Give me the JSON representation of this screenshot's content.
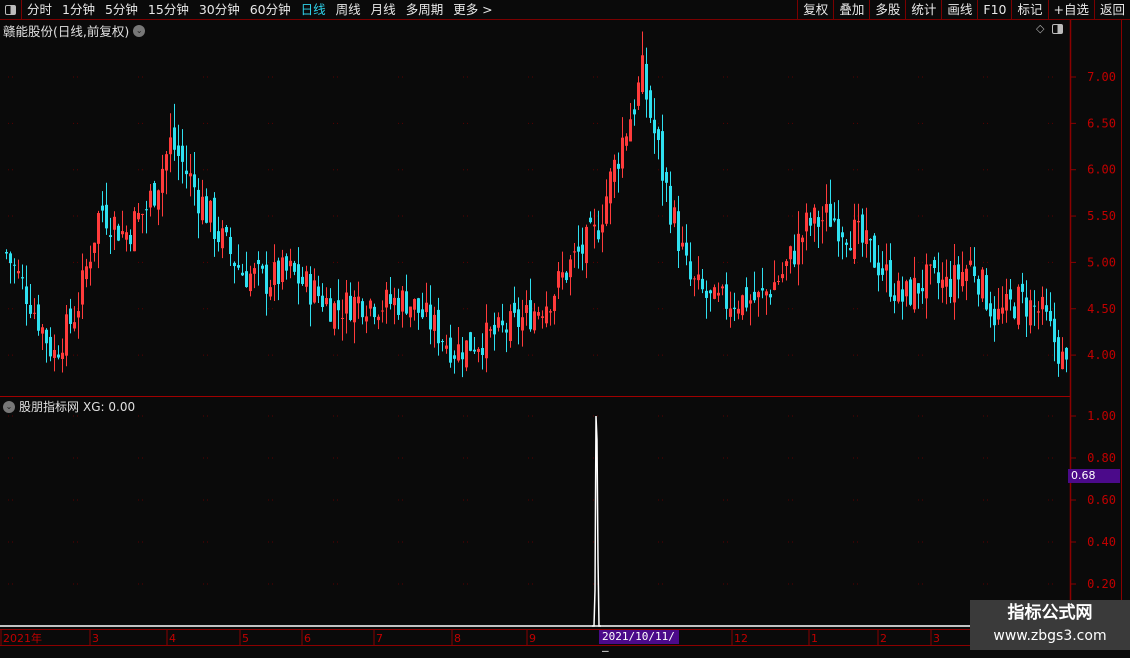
{
  "toolbar": {
    "periods": [
      "分时",
      "1分钟",
      "5分钟",
      "15分钟",
      "30分钟",
      "60分钟",
      "日线",
      "周线",
      "月线",
      "多周期",
      "更多 >"
    ],
    "active_period": "日线",
    "right_buttons": [
      "复权",
      "叠加",
      "多股",
      "统计",
      "画线",
      "F10",
      "标记",
      "+自选",
      "返回"
    ]
  },
  "main_chart": {
    "title": "赣能股份(日线,前复权)",
    "y_ticks": [
      "7.00",
      "6.50",
      "6.00",
      "5.50",
      "5.00",
      "4.50",
      "4.00"
    ],
    "up_color": "#ff3b3b",
    "down_color": "#2fe0f0"
  },
  "indicator": {
    "title": "股朋指标网",
    "value_label": "XG: 0.00",
    "y_ticks": [
      "1.00",
      "0.80",
      "0.60",
      "0.40",
      "0.20"
    ],
    "crosshair_value": "0.68",
    "signal_date": "2021/10/11/—",
    "signal_value": 1.0
  },
  "chart_data": {
    "type": "candlestick",
    "ylim": [
      3.6,
      7.4
    ],
    "close_trend": [
      5.1,
      4.6,
      4.0,
      4.5,
      5.6,
      5.3,
      5.6,
      6.3,
      5.8,
      5.3,
      4.9,
      4.8,
      4.9,
      4.7,
      4.5,
      4.6,
      4.55,
      4.6,
      4.35,
      4.05,
      4.15,
      4.25,
      4.4,
      4.6,
      5.0,
      5.3,
      6.2,
      7.0,
      5.8,
      4.8,
      4.55,
      4.6,
      4.6,
      4.9,
      5.4,
      5.5,
      5.3,
      5.0,
      4.6,
      4.8,
      4.75,
      5.0,
      4.4,
      4.6,
      4.45,
      3.85
    ],
    "x_labels": [
      "2021年",
      "3",
      "4",
      "5",
      "6",
      "7",
      "8",
      "9",
      "12",
      "1",
      "2",
      "3"
    ]
  },
  "watermark": {
    "line1": "指标公式网",
    "line2": "www.zbgs3.com"
  }
}
